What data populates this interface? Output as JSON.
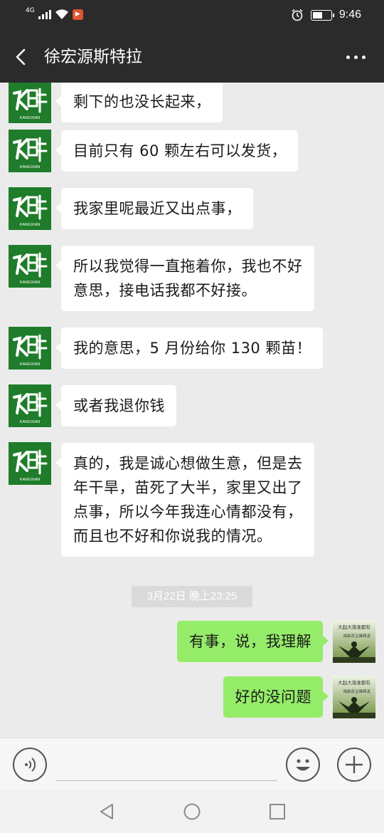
{
  "status_bar": {
    "network_type": "4G",
    "time": "9:46",
    "battery_level": 0.55,
    "icons": [
      "signal-icon",
      "wifi-icon",
      "app-notification-icon",
      "alarm-icon",
      "battery-icon"
    ]
  },
  "header": {
    "title": "徐宏源斯特拉",
    "back_icon": "chevron-left-icon",
    "more_icon": "more-dots-icon"
  },
  "messages": [
    {
      "from": "contact",
      "text": "剩下的也没长起来，"
    },
    {
      "from": "contact",
      "text": "目前只有 60 颗左右可以发货，"
    },
    {
      "from": "contact",
      "text": "我家里呢最近又出点事，"
    },
    {
      "from": "contact",
      "lines": [
        "所以我觉得一直拖着你，我也不好",
        "意思，接电话我都不好接。"
      ]
    },
    {
      "from": "contact",
      "text": "我的意思，5 月份给你 130 颗苗！"
    },
    {
      "from": "contact",
      "text": "或者我退你钱"
    },
    {
      "from": "contact",
      "lines": [
        "真的，我是诚心想做生意，但是去",
        "年干旱，苗死了大半，家里又出了",
        "点事，所以今年我连心情都没有，",
        "而且也不好和你说我的情况。"
      ]
    },
    {
      "from": "me",
      "text": "有事，说，我理解"
    },
    {
      "from": "me",
      "text": "好的没问题"
    }
  ],
  "timestamp": "3月22日 晚上23:25",
  "contact_avatar": {
    "brand_text": "KANGXIAN",
    "color": "#1f7c2a"
  },
  "my_avatar": {
    "line1": "大起大落谁都有",
    "line2": "拍拍灰尘继续走"
  },
  "input_bar": {
    "voice_icon": "voice-icon",
    "emoji_icon": "emoji-icon",
    "plus_icon": "plus-icon"
  },
  "nav_bar": [
    "back-triangle-icon",
    "home-circle-icon",
    "recents-square-icon"
  ],
  "colors": {
    "header_bg": "#2b2b2b",
    "chat_bg": "#ebebeb",
    "incoming_bubble": "#ffffff",
    "outgoing_bubble": "#95ec69"
  }
}
